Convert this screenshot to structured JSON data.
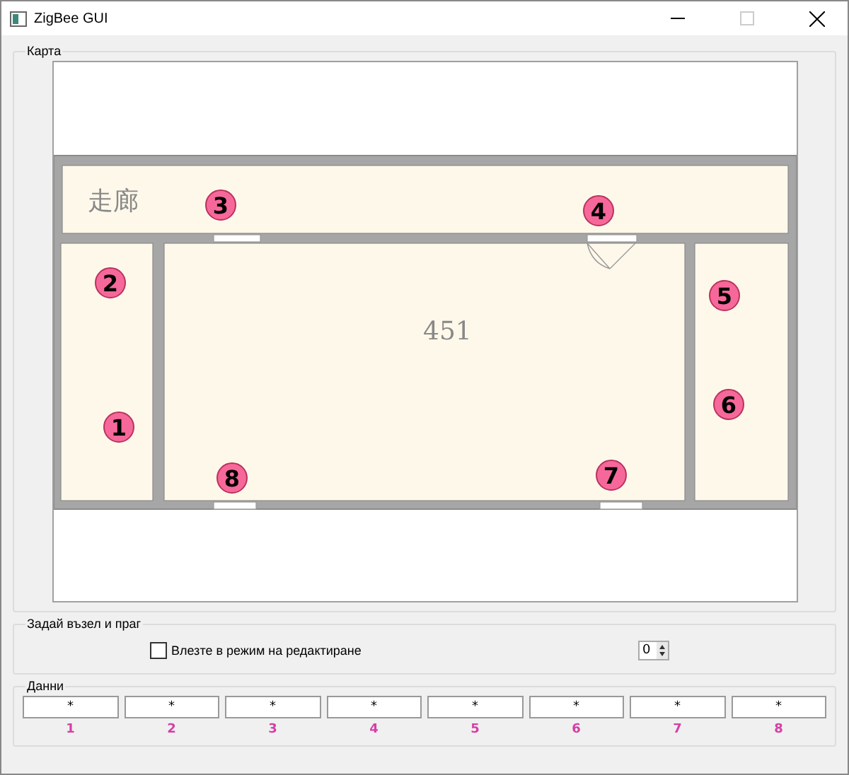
{
  "window": {
    "title": "ZigBee GUI",
    "maximize_enabled": false
  },
  "map": {
    "title": "Карта",
    "rooms": [
      {
        "label": "走廊"
      },
      {
        "label": "451"
      }
    ],
    "nodes": [
      {
        "label": "1"
      },
      {
        "label": "2"
      },
      {
        "label": "3"
      },
      {
        "label": "4"
      },
      {
        "label": "5"
      },
      {
        "label": "6"
      },
      {
        "label": "7"
      },
      {
        "label": "8"
      }
    ]
  },
  "edit": {
    "title": "Задай възел и праг",
    "checkbox": {
      "label": "Влезте в режим на редактиране",
      "checked": false
    },
    "spinbox": {
      "value": "0"
    }
  },
  "data": {
    "title": "Данни",
    "cells": [
      {
        "value": "*",
        "label": "1"
      },
      {
        "value": "*",
        "label": "2"
      },
      {
        "value": "*",
        "label": "3"
      },
      {
        "value": "*",
        "label": "4"
      },
      {
        "value": "*",
        "label": "5"
      },
      {
        "value": "*",
        "label": "6"
      },
      {
        "value": "*",
        "label": "7"
      },
      {
        "value": "*",
        "label": "8"
      }
    ]
  }
}
